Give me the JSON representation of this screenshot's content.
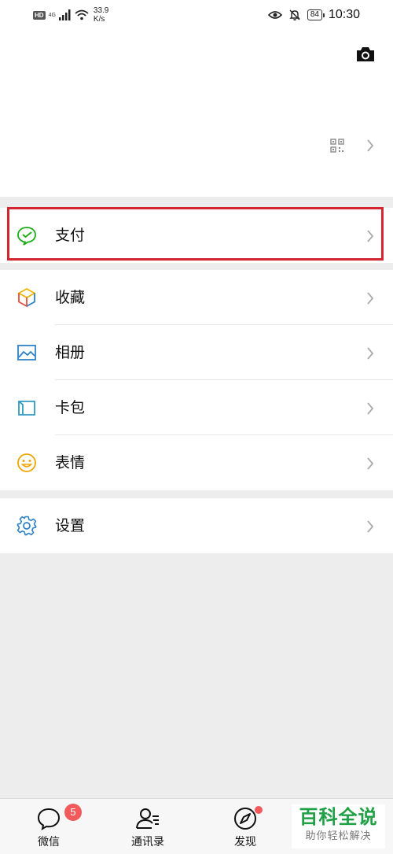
{
  "status_bar": {
    "hd": "HD",
    "network": "4G",
    "speed_value": "33.9",
    "speed_unit": "K/s",
    "battery": "84",
    "time": "10:30"
  },
  "menu": {
    "pay": "支付",
    "favorites": "收藏",
    "album": "相册",
    "cards": "卡包",
    "stickers": "表情",
    "settings": "设置"
  },
  "tabs": [
    {
      "label": "微信",
      "badge": "5"
    },
    {
      "label": "通讯录"
    },
    {
      "label": "发现"
    }
  ],
  "watermark": {
    "title": "百科全说",
    "subtitle": "助你轻松解决"
  },
  "colors": {
    "highlight": "#d22630",
    "badge": "#f15b5b",
    "wechat_green": "#1aad19"
  }
}
